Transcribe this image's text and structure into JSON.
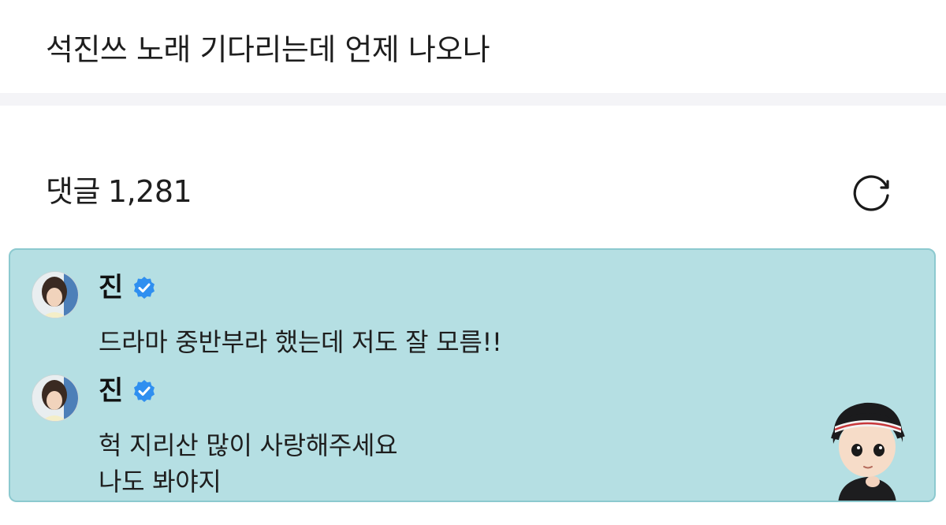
{
  "post": {
    "title": "석진쓰 노래 기다리는데 언제 나오나"
  },
  "comments": {
    "label": "댓글",
    "count": "1,281",
    "refresh_icon": "refresh-icon"
  },
  "replies": [
    {
      "author": "진",
      "verified_icon": "verified-badge-icon",
      "text_lines": [
        "드라마 중반부라 했는데 저도 잘 모름!!"
      ]
    },
    {
      "author": "진",
      "verified_icon": "verified-badge-icon",
      "text_lines": [
        "헉 지리산 많이 사랑해주세요",
        "나도 봐야지"
      ]
    }
  ],
  "colors": {
    "highlight_bg": "#b5dfe3",
    "verified_blue": "#2f8ff0"
  }
}
